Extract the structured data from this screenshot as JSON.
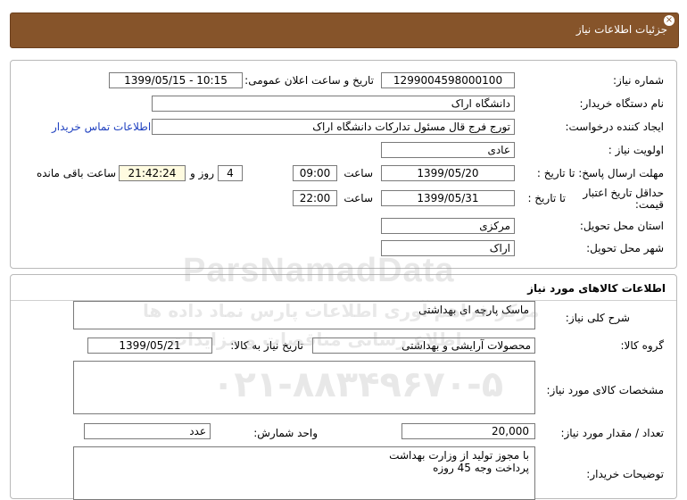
{
  "header": {
    "title": "جزئیات اطلاعات نیاز"
  },
  "info": {
    "need_number_label": "شماره نیاز:",
    "need_number": "1299004598000100",
    "announce_label": "تاریخ و ساعت اعلان عمومی:",
    "announce_value": "1399/05/15 - 10:15",
    "buyer_org_label": "نام دستگاه خریدار:",
    "buyer_org": "دانشگاه اراک",
    "creator_label": "ایجاد کننده درخواست:",
    "creator": "تورج فرج قال مسئول تدارکات دانشگاه اراک",
    "contact_link": "اطلاعات تماس خریدار",
    "priority_label": "اولویت نیاز :",
    "priority": "عادی",
    "reply_deadline_label": "مهلت ارسال پاسخ: تا تاریخ :",
    "reply_date": "1399/05/20",
    "time_label": "ساعت",
    "reply_time": "09:00",
    "days": "4",
    "days_label": "روز و",
    "remaining_time": "21:42:24",
    "remaining_label": "ساعت باقی مانده",
    "validity_label": "حداقل تاریخ اعتبار قیمت:",
    "to_date_label": "تا تاریخ :",
    "validity_date": "1399/05/31",
    "validity_time": "22:00",
    "province_label": "استان محل تحویل:",
    "province": "مرکزی",
    "city_label": "شهر محل تحویل:",
    "city": "اراک"
  },
  "goods": {
    "section_title": "اطلاعات کالاهای مورد نیاز",
    "general_desc_label": "شرح کلی نیاز:",
    "general_desc": "ماسک پارچه ای بهداشتی",
    "group_label": "گروه کالا:",
    "group": "محصولات آرایشی و بهداشتی",
    "need_date_label": "تاریخ نیاز به کالا:",
    "need_date": "1399/05/21",
    "specs_label": "مشخصات کالای مورد نیاز:",
    "specs": "",
    "qty_label": "تعداد / مقدار مورد نیاز:",
    "qty": "20,000",
    "unit_label": "واحد شمارش:",
    "unit": "عدد",
    "buyer_notes_label": "توضیحات خریدار:",
    "buyer_notes_line1": "با مجوز تولید از وزارت بهداشت",
    "buyer_notes_line2": "پرداخت وجه 45 روزه"
  },
  "watermark": {
    "brand": "ParsNamadData",
    "tagline": "مرکز فراهم آوری اطلاعات پارس نماد داده ها",
    "tagline2": "اطلاع رسانی مناقصات و مزایدات",
    "phone": "۰۲۱-۸۸۳۴۹۶۷۰-۵"
  }
}
